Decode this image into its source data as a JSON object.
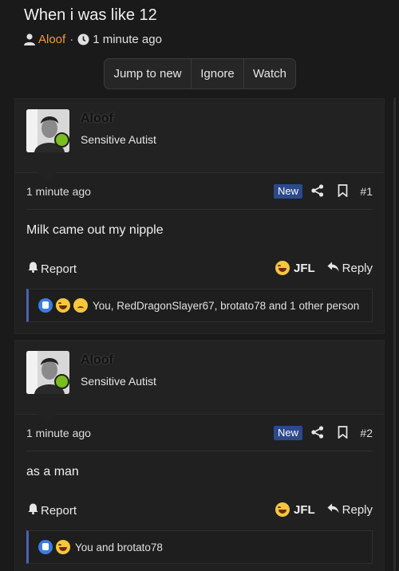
{
  "thread": {
    "title": "When i was like 12",
    "author": "Aloof",
    "time": "1 minute ago"
  },
  "toolbar": {
    "jump_label": "Jump to new",
    "ignore_label": "Ignore",
    "watch_label": "Watch"
  },
  "posts": [
    {
      "username": "Aloof",
      "user_title": "Sensitive Autist",
      "time": "1 minute ago",
      "badge": "New",
      "number": "#1",
      "body": "Milk came out my nipple",
      "report_label": "Report",
      "reaction_label": "JFL",
      "reply_label": "Reply",
      "reactions_text": "You, RedDragonSlayer67, brotato78 and 1 other person"
    },
    {
      "username": "Aloof",
      "user_title": "Sensitive Autist",
      "time": "1 minute ago",
      "badge": "New",
      "number": "#2",
      "body": "as a man",
      "report_label": "Report",
      "reaction_label": "JFL",
      "reply_label": "Reply",
      "reactions_text": "You and brotato78"
    }
  ],
  "colors": {
    "accent_author": "#f0993a",
    "new_badge": "#2a4a8a",
    "online": "#7bbd1f",
    "reaction_border": "#4a62b8"
  }
}
